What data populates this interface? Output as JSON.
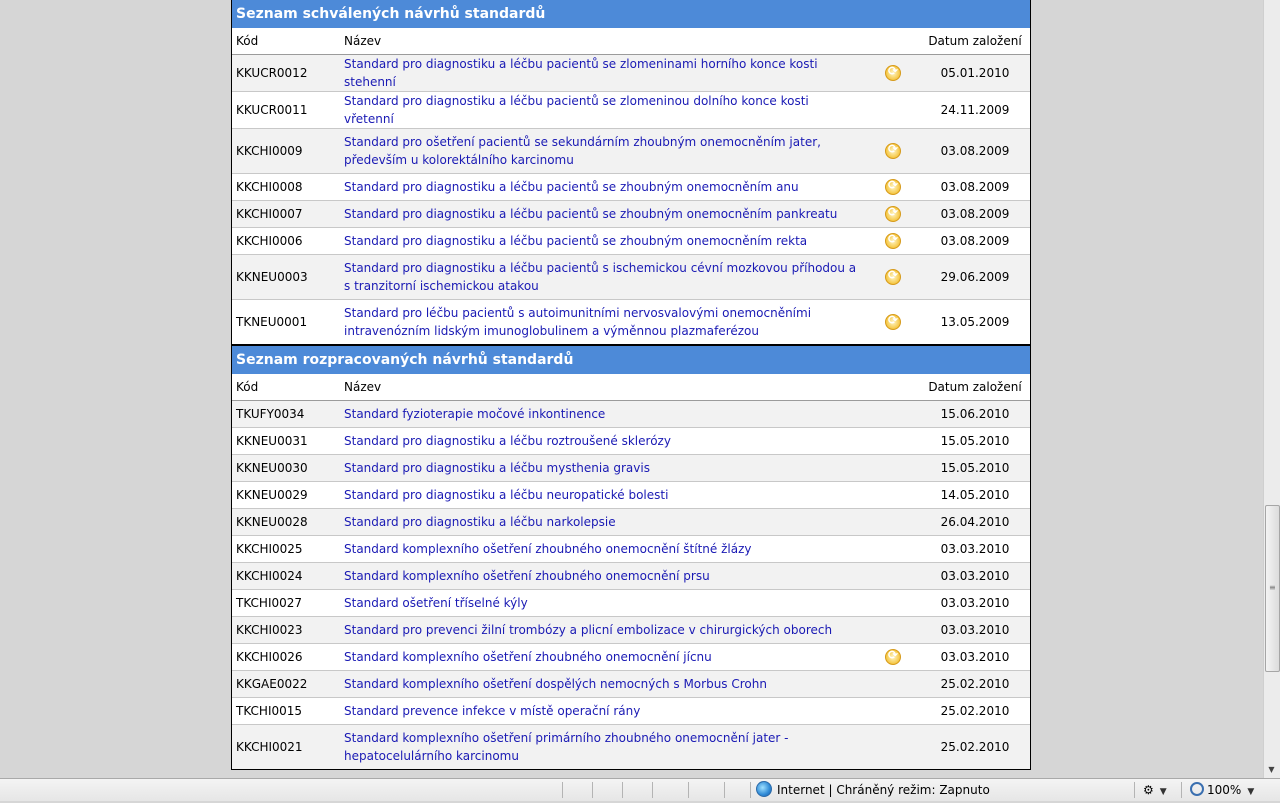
{
  "approved": {
    "title": "Seznam schválených návrhů standardů",
    "headers": {
      "code": "Kód",
      "name": "Název",
      "date": "Datum založení"
    },
    "rows": [
      {
        "code": "KKUCR0012",
        "name": "Standard pro diagnostiku a léčbu pacientů se zlomeninami horního konce kosti stehenní",
        "date": "05.01.2010",
        "icon": "refresh-icon"
      },
      {
        "code": "KKUCR0011",
        "name": "Standard pro diagnostiku a léčbu pacientů se zlomeninou dolního konce kosti vřetenní",
        "date": "24.11.2009",
        "icon": ""
      },
      {
        "code": "KKCHI0009",
        "name": "Standard pro ošetření pacientů se sekundárním zhoubným onemocněním jater, především u kolorektálního karcinomu",
        "date": "03.08.2009",
        "icon": "refresh-icon"
      },
      {
        "code": "KKCHI0008",
        "name": "Standard pro diagnostiku a léčbu pacientů se zhoubným onemocněním anu",
        "date": "03.08.2009",
        "icon": "refresh-icon"
      },
      {
        "code": "KKCHI0007",
        "name": "Standard pro diagnostiku a léčbu pacientů se zhoubným onemocněním pankreatu",
        "date": "03.08.2009",
        "icon": "refresh-icon"
      },
      {
        "code": "KKCHI0006",
        "name": "Standard pro diagnostiku a léčbu pacientů se zhoubným onemocněním rekta",
        "date": "03.08.2009",
        "icon": "refresh-icon"
      },
      {
        "code": "KKNEU0003",
        "name": "Standard pro diagnostiku a léčbu pacientů s ischemickou cévní mozkovou příhodou a s tranzitorní ischemickou atakou",
        "date": "29.06.2009",
        "icon": "refresh-icon"
      },
      {
        "code": "TKNEU0001",
        "name": "Standard pro léčbu pacientů s autoimunitními nervosvalovými onemocněními intravenózním lidským imunoglobulinem a výměnnou plazmaferézou",
        "date": "13.05.2009",
        "icon": "refresh-icon"
      }
    ]
  },
  "inprogress": {
    "title": "Seznam rozpracovaných návrhů standardů",
    "headers": {
      "code": "Kód",
      "name": "Název",
      "date": "Datum založení"
    },
    "rows": [
      {
        "code": "TKUFY0034",
        "name": "Standard fyzioterapie močové inkontinence",
        "date": "15.06.2010",
        "icon": ""
      },
      {
        "code": "KKNEU0031",
        "name": "Standard pro diagnostiku a léčbu roztroušené sklerózy",
        "date": "15.05.2010",
        "icon": ""
      },
      {
        "code": "KKNEU0030",
        "name": "Standard pro diagnostiku a léčbu mysthenia gravis",
        "date": "15.05.2010",
        "icon": ""
      },
      {
        "code": "KKNEU0029",
        "name": "Standard pro diagnostiku a léčbu neuropatické bolesti",
        "date": "14.05.2010",
        "icon": ""
      },
      {
        "code": "KKNEU0028",
        "name": "Standard pro diagnostiku a léčbu narkolepsie",
        "date": "26.04.2010",
        "icon": ""
      },
      {
        "code": "KKCHI0025",
        "name": "Standard komplexního ošetření zhoubného onemocnění štítné žlázy",
        "date": "03.03.2010",
        "icon": ""
      },
      {
        "code": "KKCHI0024",
        "name": "Standard komplexního ošetření zhoubného onemocnění prsu",
        "date": "03.03.2010",
        "icon": ""
      },
      {
        "code": "TKCHI0027",
        "name": "Standard ošetření tříselné kýly",
        "date": "03.03.2010",
        "icon": ""
      },
      {
        "code": "KKCHI0023",
        "name": "Standard pro prevenci žilní trombózy a plicní embolizace v chirurgických oborech",
        "date": "03.03.2010",
        "icon": ""
      },
      {
        "code": "KKCHI0026",
        "name": "Standard komplexního ošetření zhoubného onemocnění jícnu",
        "date": "03.03.2010",
        "icon": "refresh-icon"
      },
      {
        "code": "KKGAE0022",
        "name": "Standard komplexního ošetření dospělých nemocných s Morbus Crohn",
        "date": "25.02.2010",
        "icon": ""
      },
      {
        "code": "TKCHI0015",
        "name": "Standard prevence infekce v místě operační rány",
        "date": "25.02.2010",
        "icon": ""
      },
      {
        "code": "KKCHI0021",
        "name": "Standard komplexního ošetření primárního zhoubného onemocnění jater - hepatocelulárního karcinomu",
        "date": "25.02.2010",
        "icon": ""
      }
    ]
  },
  "statusbar": {
    "zone": "Internet | Chráněný režim: Zapnuto",
    "zoom": "100%"
  }
}
